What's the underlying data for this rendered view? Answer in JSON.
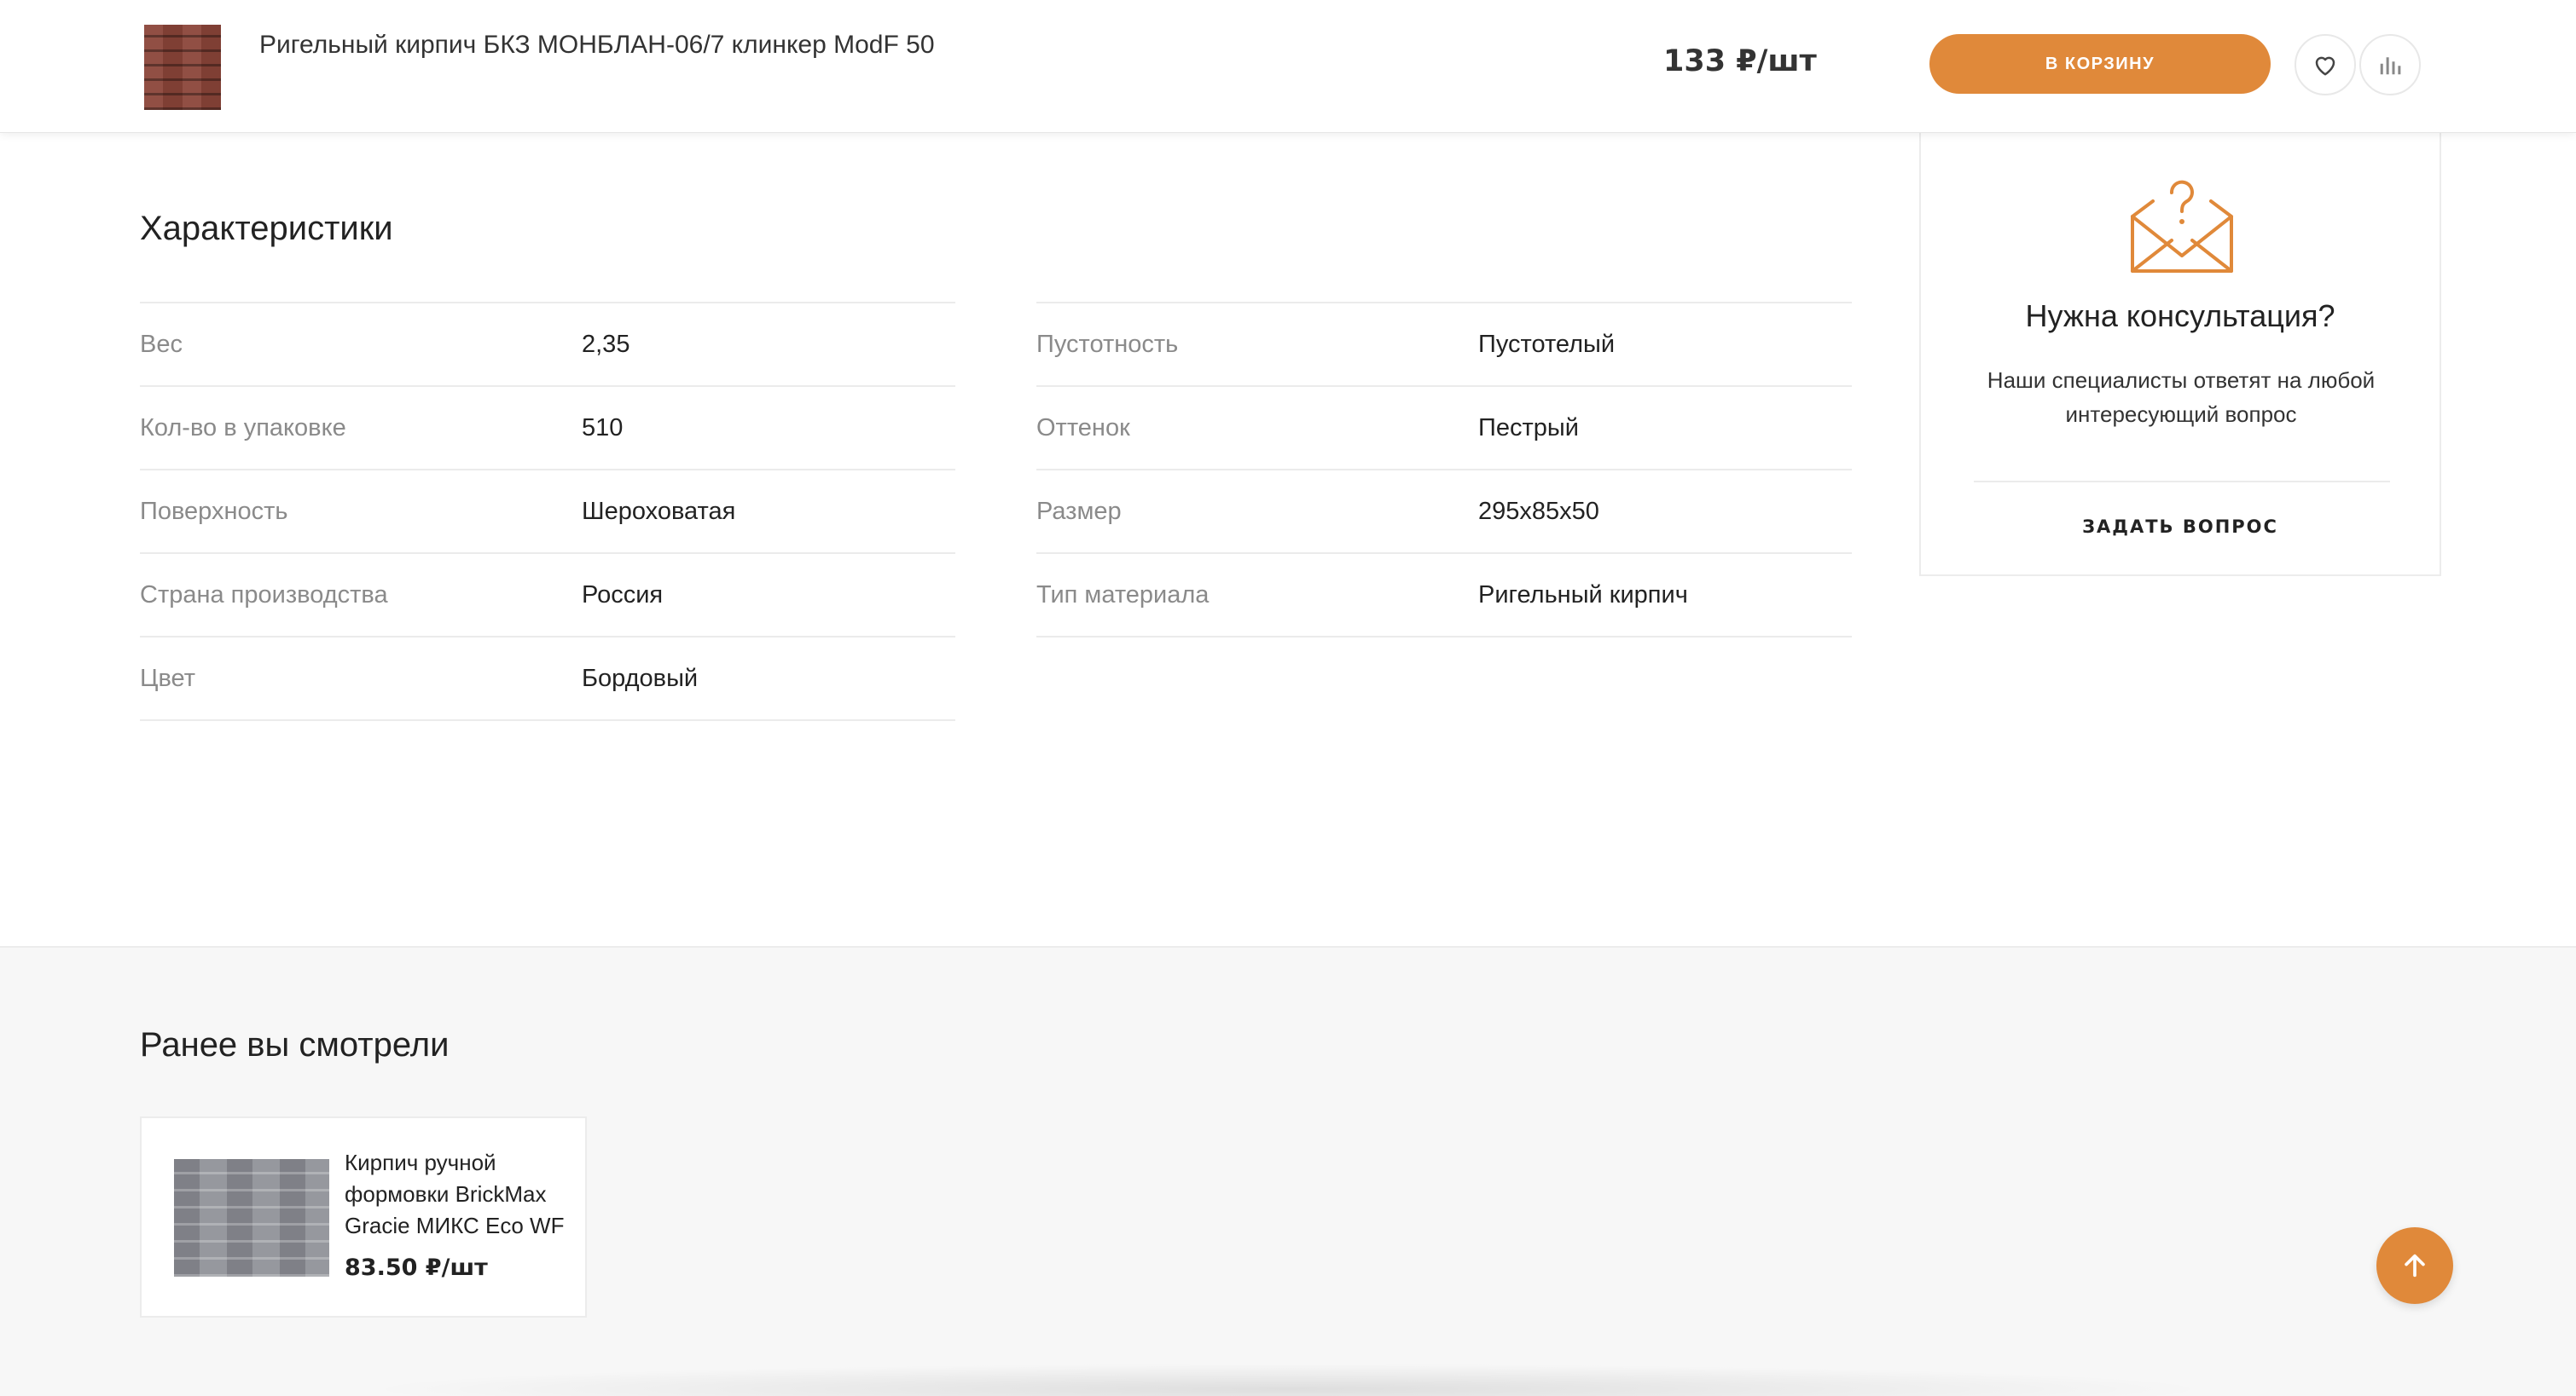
{
  "header": {
    "product_title": "Ригельный кирпич БКЗ МОНБЛАН-06/7 клинкер ModF 50",
    "price": "133 ₽/шт",
    "cart_button_label": "В КОРЗИНУ",
    "favorite_icon": "heart-icon",
    "compare_icon": "bar-chart-icon"
  },
  "specs": {
    "title": "Характеристики",
    "left": [
      {
        "label": "Вес",
        "value": "2,35"
      },
      {
        "label": "Кол-во в упаковке",
        "value": "510"
      },
      {
        "label": "Поверхность",
        "value": "Шероховатая"
      },
      {
        "label": "Страна производства",
        "value": "Россия"
      },
      {
        "label": "Цвет",
        "value": "Бордовый"
      }
    ],
    "right": [
      {
        "label": "Пустотность",
        "value": "Пустотелый"
      },
      {
        "label": "Оттенок",
        "value": "Пестрый"
      },
      {
        "label": "Размер",
        "value": "295x85x50"
      },
      {
        "label": "Тип материала",
        "value": "Ригельный кирпич"
      }
    ]
  },
  "consultation": {
    "icon": "envelope-question-icon",
    "title": "Нужна консультация?",
    "text": "Наши специалисты ответят на любой интересующий вопрос",
    "link_label": "ЗАДАТЬ ВОПРОС"
  },
  "recently_viewed": {
    "title": "Ранее вы смотрели",
    "items": [
      {
        "name": "Кирпич ручной формовки BrickMax Gracie МИКС Eco WF",
        "price": "83.50 ₽/шт"
      }
    ]
  },
  "colors": {
    "accent": "#e0893a",
    "label_gray": "#8a8a8a",
    "section_bg": "#f7f7f7"
  },
  "scroll_top_icon": "arrow-up-icon"
}
